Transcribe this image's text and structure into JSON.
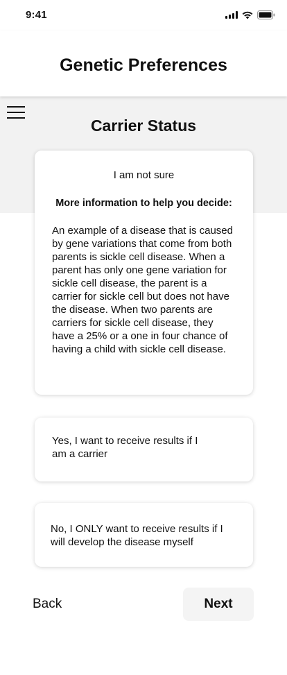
{
  "status_bar": {
    "time": "9:41",
    "icons": [
      "signal-icon",
      "wifi-icon",
      "battery-icon"
    ]
  },
  "header": {
    "title": "Genetic Preferences"
  },
  "menu": {
    "icon": "hamburger-menu-icon"
  },
  "section": {
    "title": "Carrier Status"
  },
  "options": {
    "not_sure": {
      "label": "I am not sure",
      "info_heading": "More information to help you decide:",
      "info_body": "An example of a disease that is caused by gene variations that come from both parents is sickle cell disease. When a parent has only one gene variation for sickle cell disease, the parent is a carrier for sickle cell but does not have the disease. When two parents are carriers for sickle cell disease, they have a 25% or a one in four chance of having a child with sickle cell disease."
    },
    "yes_carrier": {
      "label": "Yes, I want to receive results if I am a carrier"
    },
    "no_only_disease": {
      "label": "No, I ONLY want to receive results if I will develop the disease myself"
    }
  },
  "footer": {
    "back_label": "Back",
    "next_label": "Next"
  },
  "colors": {
    "band_background": "#f2f2f2",
    "card_background": "#ffffff",
    "next_button_background": "#f4f4f4",
    "text": "#111111"
  }
}
